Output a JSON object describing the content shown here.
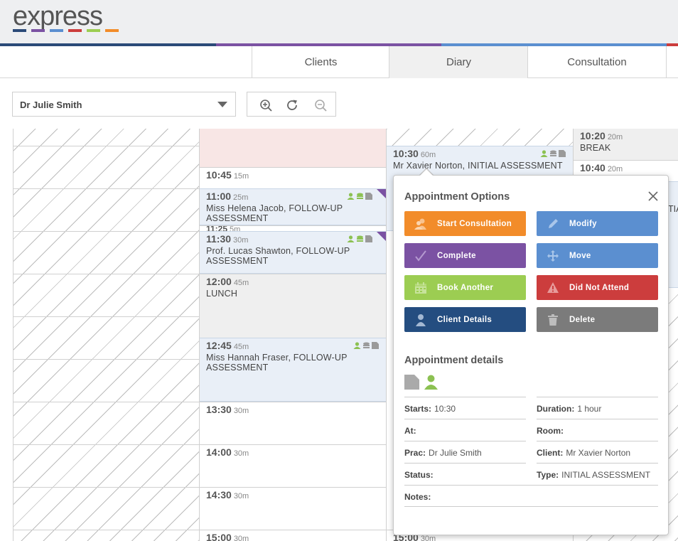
{
  "app": {
    "logo": "express",
    "logo_colors": [
      "#2b4a78",
      "#7b52a3",
      "#5b8fd0",
      "#cc3d3d",
      "#9ccd52",
      "#f28c2a"
    ],
    "accent_bar": [
      "#2b4a78",
      "#7b52a3",
      "#5b8fd0",
      "#cc3d3d"
    ]
  },
  "nav": {
    "tabs": [
      {
        "label": "Clients",
        "active": false
      },
      {
        "label": "Diary",
        "active": true
      },
      {
        "label": "Consultation",
        "active": false
      }
    ]
  },
  "toolbar": {
    "practitioner": "Dr Julie Smith",
    "zoom_icons": [
      "zoom-in-icon",
      "refresh-icon",
      "zoom-out-icon"
    ]
  },
  "diary": {
    "col2": [
      {
        "time": "10:45",
        "dur": "15m",
        "desc": ""
      },
      {
        "time": "11:00",
        "dur": "25m",
        "desc": "Miss Helena Jacob, FOLLOW-UP ASSESSMENT"
      },
      {
        "time": "11:25",
        "dur": "5m",
        "desc": ""
      },
      {
        "time": "11:30",
        "dur": "30m",
        "desc": "Prof. Lucas Shawton, FOLLOW-UP ASSESSMENT"
      },
      {
        "time": "12:00",
        "dur": "45m",
        "desc": "LUNCH"
      },
      {
        "time": "12:45",
        "dur": "45m",
        "desc": "Miss Hannah Fraser, FOLLOW-UP ASSESSMENT"
      },
      {
        "time": "13:30",
        "dur": "30m",
        "desc": ""
      },
      {
        "time": "14:00",
        "dur": "30m",
        "desc": ""
      },
      {
        "time": "14:30",
        "dur": "30m",
        "desc": ""
      },
      {
        "time": "15:00",
        "dur": "30m",
        "desc": ""
      }
    ],
    "col3": [
      {
        "time": "10:30",
        "dur": "60m",
        "desc": "Mr Xavier Norton, INITIAL ASSESSMENT"
      },
      {
        "time": "15:00",
        "dur": "30m",
        "desc": ""
      }
    ],
    "col4": [
      {
        "time": "10:20",
        "dur": "20m",
        "desc": "BREAK"
      },
      {
        "time": "10:40",
        "dur": "20m",
        "desc": ""
      }
    ],
    "col4_partial": "TIA"
  },
  "popup": {
    "options_title": "Appointment Options",
    "buttons": {
      "start": {
        "label": "Start Consultation",
        "color": "#f28c2a"
      },
      "modify": {
        "label": "Modify",
        "color": "#5b8fd0"
      },
      "complete": {
        "label": "Complete",
        "color": "#7b52a3"
      },
      "move": {
        "label": "Move",
        "color": "#5b8fd0"
      },
      "book": {
        "label": "Book Another",
        "color": "#9ccd52"
      },
      "dna": {
        "label": "Did Not Attend",
        "color": "#cc3d3d"
      },
      "client": {
        "label": "Client Details",
        "color": "#244d80"
      },
      "delete": {
        "label": "Delete",
        "color": "#7b7b7b"
      }
    },
    "details_title": "Appointment details",
    "fields": {
      "starts": {
        "label": "Starts:",
        "value": "10:30"
      },
      "duration": {
        "label": "Duration:",
        "value": "1 hour"
      },
      "at": {
        "label": "At:",
        "value": ""
      },
      "room": {
        "label": "Room:",
        "value": ""
      },
      "prac": {
        "label": "Prac:",
        "value": "Dr Julie Smith"
      },
      "client": {
        "label": "Client:",
        "value": "Mr Xavier Norton"
      },
      "status": {
        "label": "Status:",
        "value": ""
      },
      "type": {
        "label": "Type:",
        "value": "INITIAL ASSESSMENT"
      },
      "notes": {
        "label": "Notes:",
        "value": ""
      }
    }
  }
}
